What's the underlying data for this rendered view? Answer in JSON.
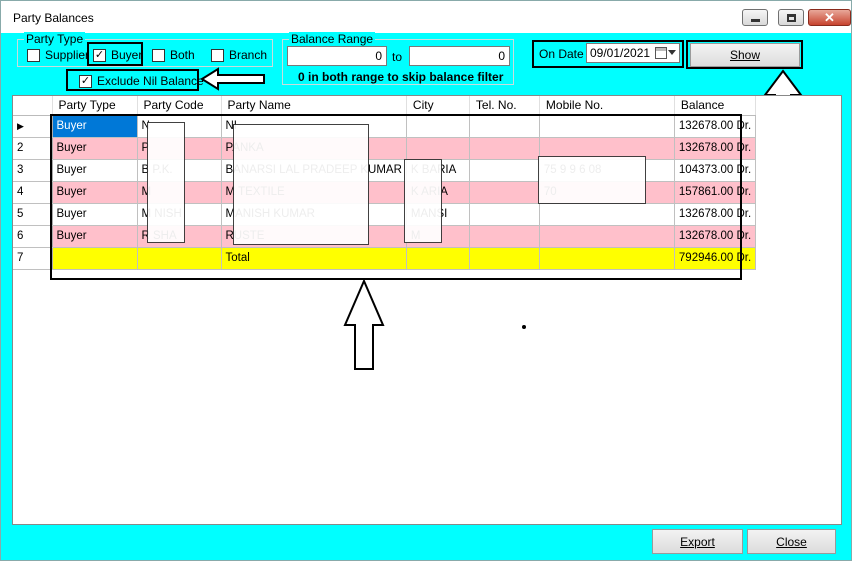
{
  "window": {
    "title": "Party Balances"
  },
  "party_type": {
    "label": "Party Type",
    "options": [
      {
        "label": "Supplier",
        "checked": false
      },
      {
        "label": "Buyer",
        "checked": true
      },
      {
        "label": "Both",
        "checked": false
      },
      {
        "label": "Branch",
        "checked": false
      }
    ],
    "exclude_nil": {
      "label": "Exclude Nil Balance",
      "checked": true
    }
  },
  "balance_range": {
    "label": "Balance Range",
    "from_value": "0",
    "to_label": "to",
    "to_value": "0",
    "note": "0 in both range to skip balance filter"
  },
  "on_date": {
    "label": "On Date",
    "value": "09/01/2021"
  },
  "buttons": {
    "show": "Show",
    "export": "Export",
    "close": "Close"
  },
  "grid": {
    "columns": [
      "Party Type",
      "Party Code",
      "Party Name",
      "City",
      "Tel. No.",
      "Mobile No.",
      "Balance"
    ],
    "rows": [
      {
        "num": "",
        "cells": [
          "Buyer",
          "N",
          "NI",
          "",
          "",
          "",
          "132678.00 Dr."
        ],
        "style": "white"
      },
      {
        "num": "2",
        "cells": [
          "Buyer",
          "P",
          "PANKA",
          "",
          "",
          "",
          "132678.00 Dr."
        ],
        "style": "pink"
      },
      {
        "num": "3",
        "cells": [
          "Buyer",
          "B  P.K.",
          "BANARSI LAL PRADEEP KUMAR",
          "K    BARIA",
          "",
          "75          9   9    6   08",
          "104373.00 Dr."
        ],
        "style": "white"
      },
      {
        "num": "4",
        "cells": [
          "Buyer",
          "M",
          "M  TEXTILE",
          "K     ARIA",
          "",
          "70",
          "157861.00 Dr."
        ],
        "style": "pink"
      },
      {
        "num": "5",
        "cells": [
          "Buyer",
          "M   NISH",
          "MANISH KUMAR",
          "MANSI",
          "",
          "",
          "132678.00 Dr."
        ],
        "style": "white"
      },
      {
        "num": "6",
        "cells": [
          "Buyer",
          "R   SHA",
          "RUSTE",
          "M",
          "",
          "",
          "132678.00 Dr."
        ],
        "style": "pink"
      },
      {
        "num": "7",
        "cells": [
          "",
          "",
          "Total",
          "",
          "",
          "",
          "792946.00 Dr."
        ],
        "style": "total"
      }
    ]
  },
  "colors": {
    "background": "#00ffff",
    "pink_row": "#ffc0cb",
    "total_row": "#ffff00",
    "selection": "#0078d7"
  }
}
